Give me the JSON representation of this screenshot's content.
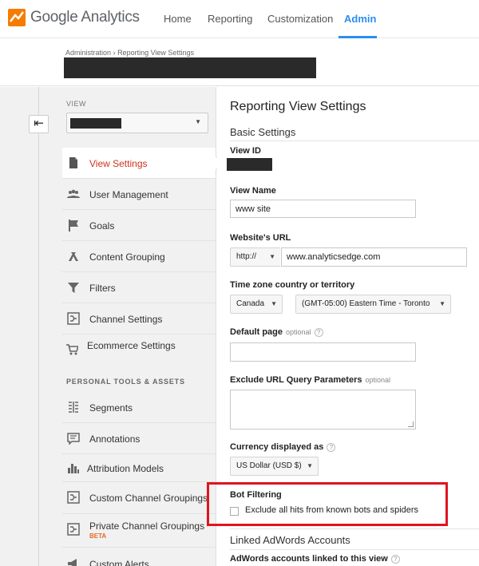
{
  "header": {
    "brand_google": "Google",
    "brand_product": "Analytics",
    "nav": [
      "Home",
      "Reporting",
      "Customization",
      "Admin"
    ],
    "active_nav": "Admin",
    "accent_color": "#2b8ef0"
  },
  "breadcrumb": {
    "root": "Administration",
    "separator": "›",
    "current": "Reporting View Settings"
  },
  "sidebar": {
    "back_label": "⇤",
    "view_label": "VIEW",
    "view_selected": "",
    "section_personal": "PERSONAL TOOLS & ASSETS",
    "items": [
      {
        "label": "View Settings",
        "icon": "document-icon",
        "active": true
      },
      {
        "label": "User Management",
        "icon": "users-icon"
      },
      {
        "label": "Goals",
        "icon": "flag-icon"
      },
      {
        "label": "Content Grouping",
        "icon": "content-grouping-icon"
      },
      {
        "label": "Filters",
        "icon": "funnel-icon"
      },
      {
        "label": "Channel Settings",
        "icon": "channel-settings-icon"
      },
      {
        "label": "Ecommerce Settings",
        "icon": "cart-icon"
      }
    ],
    "personal_items": [
      {
        "label": "Segments",
        "icon": "segments-icon"
      },
      {
        "label": "Annotations",
        "icon": "annotation-icon"
      },
      {
        "label": "Attribution Models",
        "icon": "bar-chart-icon"
      },
      {
        "label": "Custom Channel Groupings",
        "icon": "channel-grouping-icon"
      },
      {
        "label": "Private Channel Groupings",
        "icon": "channel-grouping-icon",
        "badge": "BETA"
      },
      {
        "label": "Custom Alerts",
        "icon": "megaphone-icon"
      }
    ]
  },
  "main": {
    "title": "Reporting View Settings",
    "basic_settings": "Basic Settings",
    "view_id_label": "View ID",
    "view_name_label": "View Name",
    "view_name_value": "www site",
    "website_url_label": "Website's URL",
    "protocol_value": "http://",
    "url_value": "www.analyticsedge.com",
    "timezone_label": "Time zone country or territory",
    "country_value": "Canada",
    "timezone_value": "(GMT-05:00) Eastern Time - Toronto",
    "default_page_label": "Default page",
    "optional": "optional",
    "default_page_value": "",
    "exclude_params_label": "Exclude URL Query Parameters",
    "exclude_params_value": "",
    "currency_label": "Currency displayed as",
    "currency_value": "US Dollar (USD $)",
    "bot_filtering_label": "Bot Filtering",
    "bot_filtering_checkbox": "Exclude all hits from known bots and spiders",
    "bot_filtering_checked": false,
    "linked_adwords": "Linked AdWords Accounts",
    "adwords_linked_label": "AdWords accounts linked to this view",
    "help_glyph": "?",
    "highlight_color": "#e0141e"
  }
}
